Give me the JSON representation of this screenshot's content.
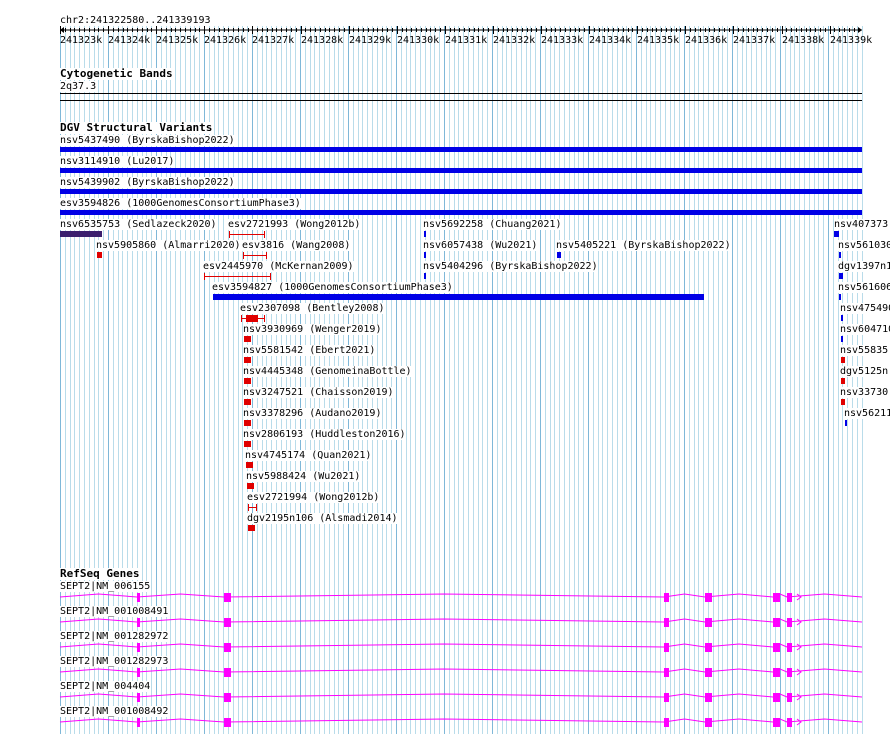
{
  "ruler": {
    "locus": "chr2:241322580..241339193",
    "ticks": [
      "241323k",
      "241324k",
      "241325k",
      "241326k",
      "241327k",
      "241328k",
      "241329k",
      "241330k",
      "241331k",
      "241332k",
      "241333k",
      "241334k",
      "241335k",
      "241336k",
      "241337k",
      "241338k",
      "241339k"
    ]
  },
  "cytoband": {
    "title": "Cytogenetic Bands",
    "band": "2q37.3"
  },
  "dgv": {
    "title": "DGV Structural Variants",
    "colors": {
      "gain": "#0000e6",
      "loss": "#e00000",
      "complex": "#3a1f6e"
    },
    "labels": {
      "nsv5437490": "nsv5437490 (ByrskaBishop2022)",
      "nsv3114910": "nsv3114910 (Lu2017)",
      "nsv5439902": "nsv5439902 (ByrskaBishop2022)",
      "esv3594826": "esv3594826 (1000GenomesConsortiumPhase3)",
      "nsv6535753": "nsv6535753 (Sedlazeck2020)",
      "esv2721993": "esv2721993 (Wong2012b)",
      "nsv5692258": "nsv5692258 (Chuang2021)",
      "nsv4073730": "nsv407373",
      "nsv5905860": "nsv5905860 (Almarri2020)",
      "esv3816": "esv3816 (Wang2008)",
      "nsv6057438": "nsv6057438 (Wu2021)",
      "nsv5405221": "nsv5405221 (ByrskaBishop2022)",
      "nsv561030": "nsv561030",
      "esv2445970": "esv2445970 (McKernan2009)",
      "nsv5404296": "nsv5404296 (ByrskaBishop2022)",
      "dgv1397n1": "dgv1397n1",
      "esv3594827": "esv3594827 (1000GenomesConsortiumPhase3)",
      "nsv561606": "nsv561606",
      "esv2307098": "esv2307098 (Bentley2008)",
      "nsv475490": "nsv475490",
      "nsv3930969": "nsv3930969 (Wenger2019)",
      "nsv604710": "nsv604710",
      "nsv5581542": "nsv5581542 (Ebert2021)",
      "nsv55835": "nsv55835",
      "nsv4445348": "nsv4445348 (GenomeinaBottle)",
      "dgv5125n": "dgv5125n",
      "nsv3247521": "nsv3247521 (Chaisson2019)",
      "nsv33730": "nsv33730",
      "nsv3378296": "nsv3378296 (Audano2019)",
      "nsv56211": "nsv56211",
      "nsv2806193": "nsv2806193 (Huddleston2016)",
      "nsv4745174": "nsv4745174 (Quan2021)",
      "nsv5988424": "nsv5988424 (Wu2021)",
      "esv2721994": "esv2721994 (Wong2012b)",
      "dgv2195n106": "dgv2195n106 (Alsmadi2014)"
    }
  },
  "refseq": {
    "title": "RefSeq Genes",
    "color": "#ff00ff",
    "transcripts": [
      "SEPT2|NM_006155",
      "SEPT2|NM_001008491",
      "SEPT2|NM_001282972",
      "SEPT2|NM_001282973",
      "SEPT2|NM_004404",
      "SEPT2|NM_001008492"
    ]
  }
}
